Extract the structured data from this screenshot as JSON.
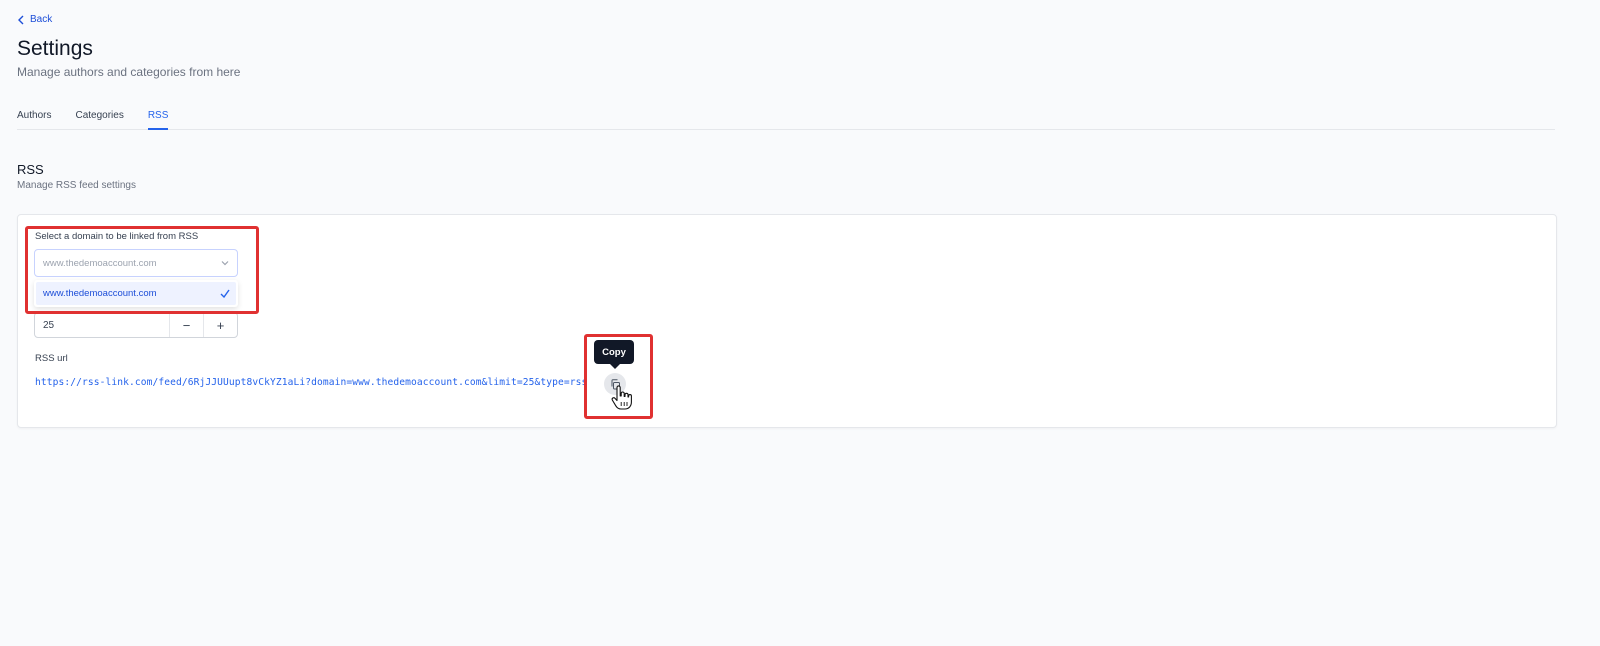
{
  "back": {
    "label": "Back",
    "icon": "chevron-left-icon"
  },
  "header": {
    "title": "Settings",
    "subtitle": "Manage authors and categories from here"
  },
  "tabs": [
    {
      "label": "Authors",
      "active": false
    },
    {
      "label": "Categories",
      "active": false
    },
    {
      "label": "RSS",
      "active": true
    }
  ],
  "section": {
    "title": "RSS",
    "subtitle": "Manage RSS feed settings"
  },
  "domain": {
    "label": "Select a domain to be linked from RSS",
    "placeholder": "www.thedemoaccount.com",
    "options": [
      {
        "label": "www.thedemoaccount.com",
        "selected": true
      }
    ]
  },
  "limit": {
    "value": "25",
    "decrement": "−",
    "increment": "+"
  },
  "rss_url": {
    "label": "RSS url",
    "value": "https://rss-link.com/feed/6RjJJUUupt8vCkYZ1aLi?domain=www.thedemoaccount.com&limit=25&type=rss",
    "copy_tooltip": "Copy",
    "copy_icon": "copy-icon"
  },
  "colors": {
    "accent": "#2563eb",
    "highlight": "#e03131",
    "background": "#f9fafc"
  }
}
